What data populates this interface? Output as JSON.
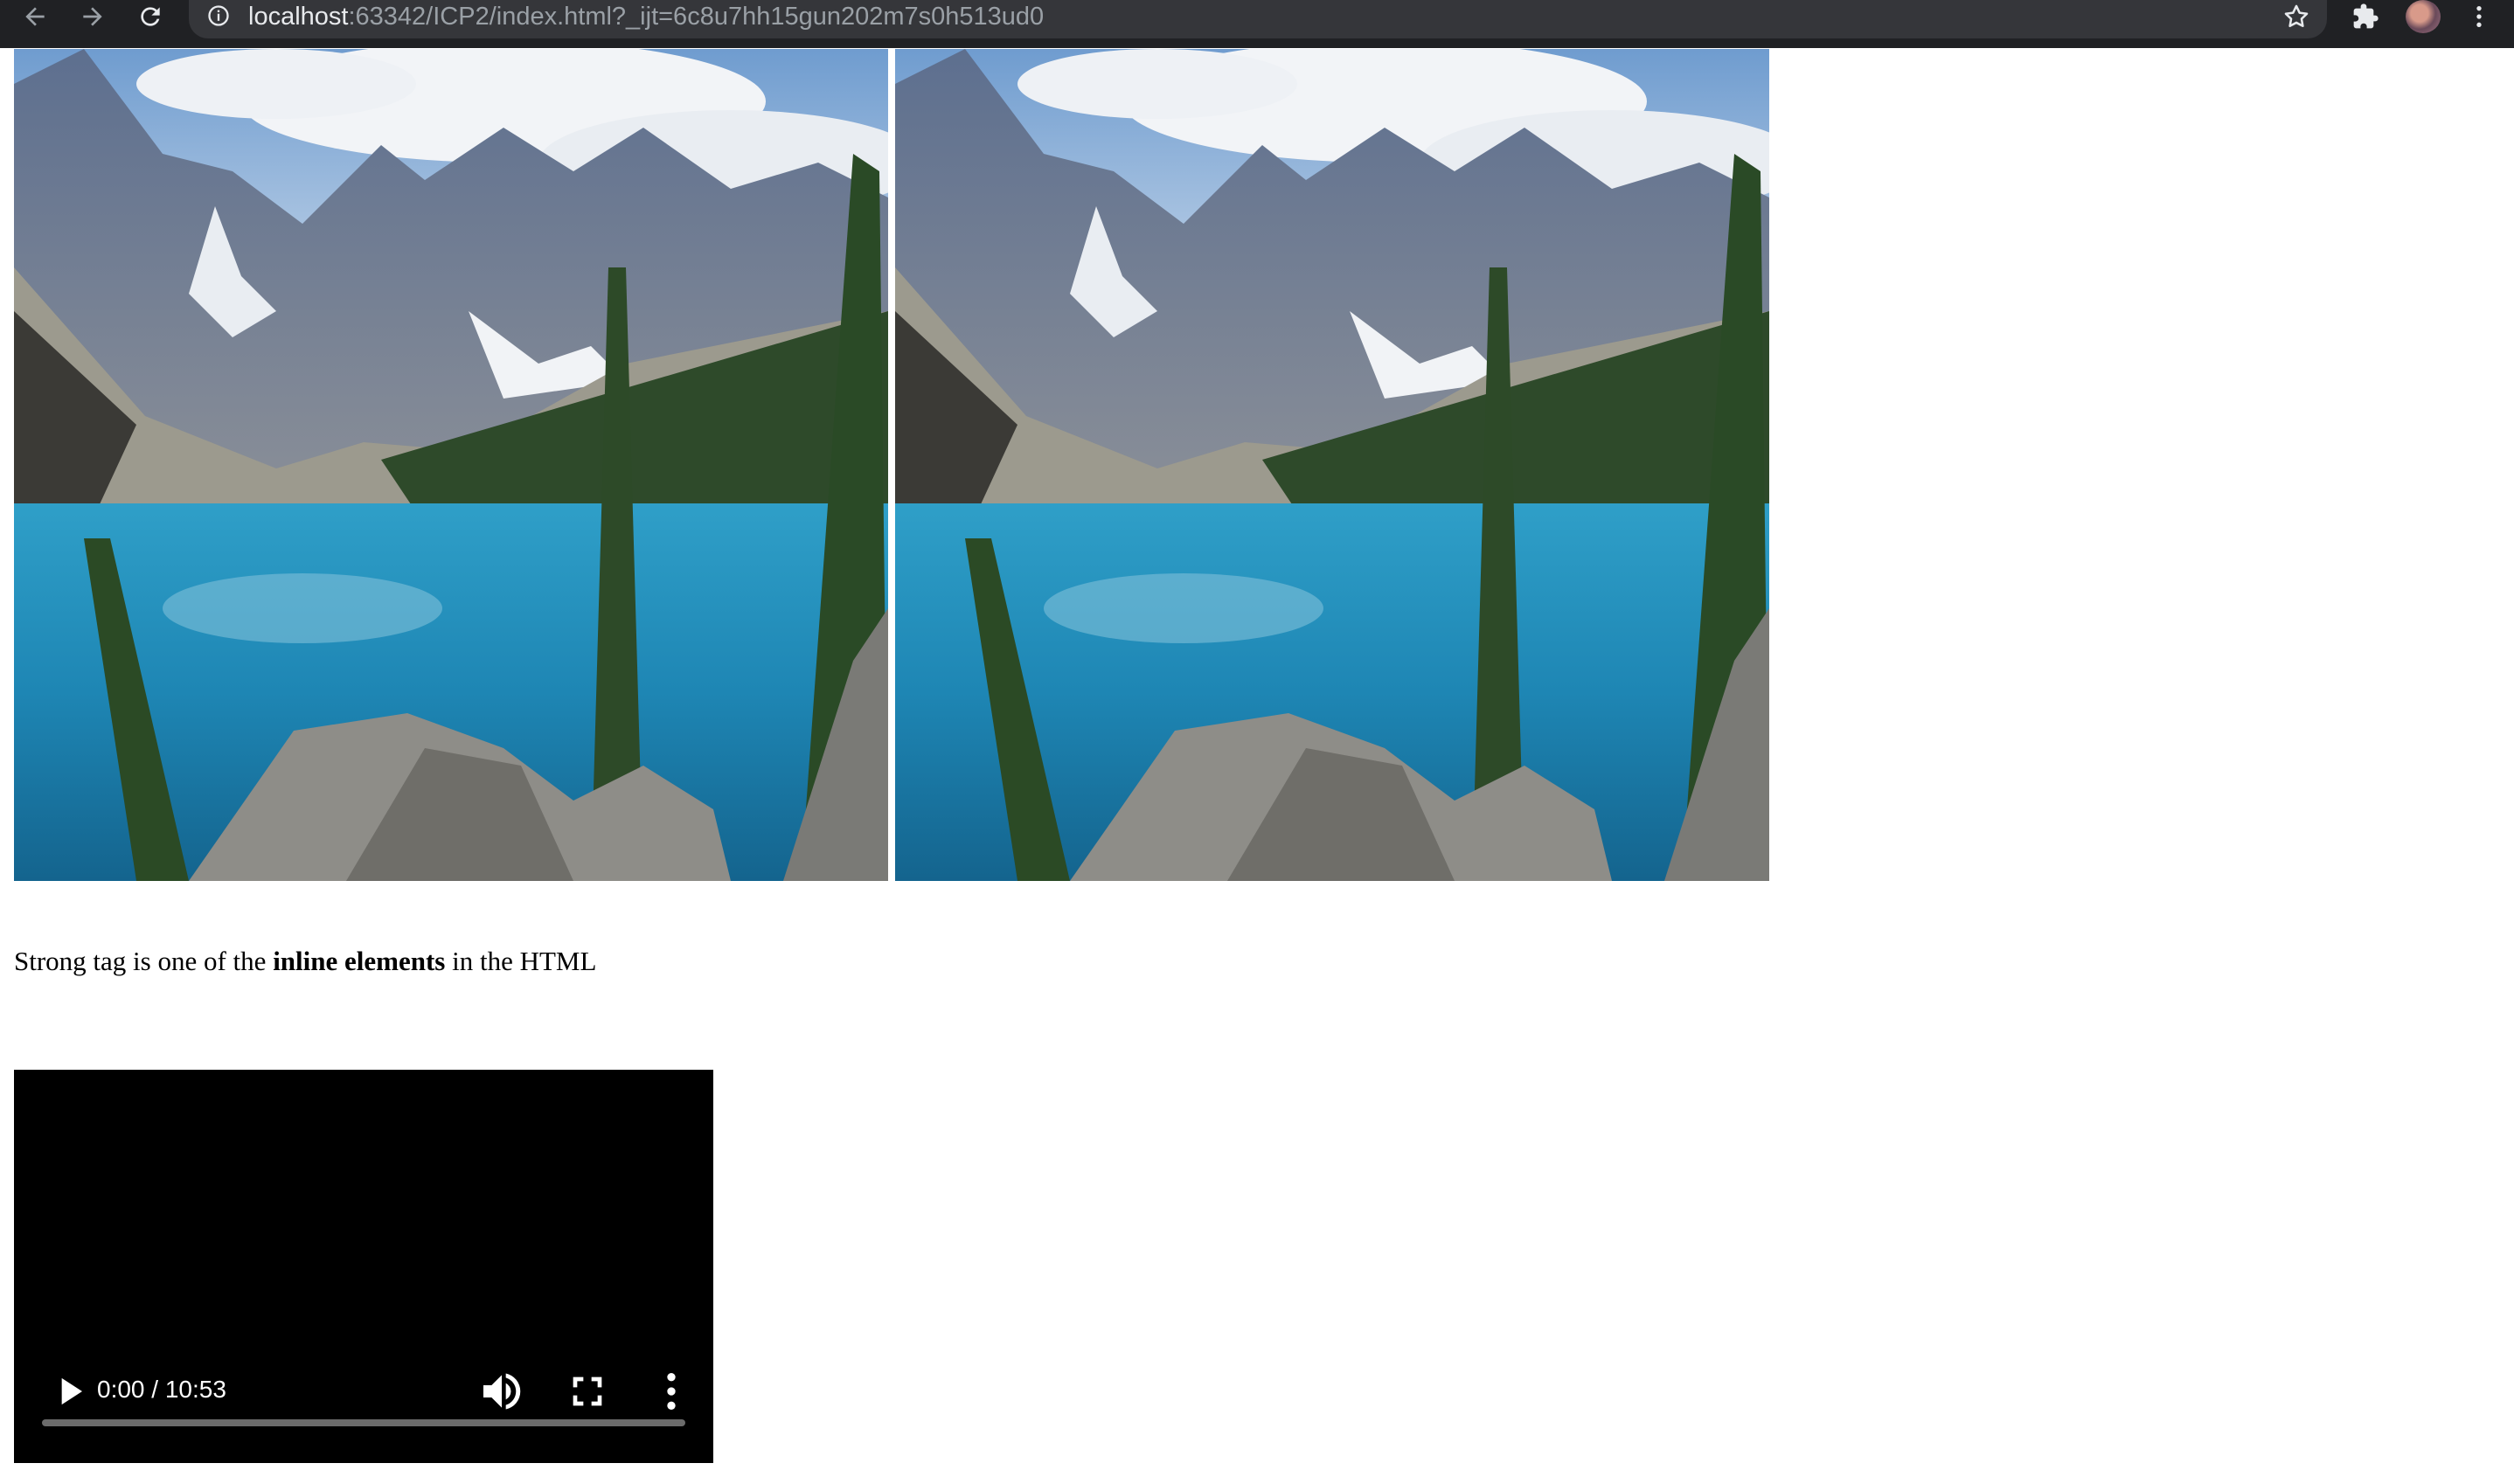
{
  "browser": {
    "url_host": "localhost",
    "url_rest": ":63342/ICP2/index.html?_ijt=6c8u7hh15gun202m7s0h513ud0",
    "back_icon": "arrow-left-icon",
    "forward_icon": "arrow-right-icon",
    "reload_icon": "reload-icon",
    "info_icon": "info-icon",
    "bookmark_icon": "star-icon",
    "extensions_icon": "puzzle-icon",
    "menu_icon": "more-vert-icon"
  },
  "images": [
    {
      "subject": "mountain lake landscape"
    },
    {
      "subject": "mountain lake landscape"
    }
  ],
  "paragraph": {
    "before": "Strong tag is one of the ",
    "strong": "inline elements",
    "after": " in the HTML"
  },
  "video": {
    "time": "0:00 / 10:53",
    "progress": 0,
    "play_icon": "play-icon",
    "volume_icon": "volume-icon",
    "fullscreen_icon": "fullscreen-icon",
    "more_icon": "more-vert-icon"
  }
}
